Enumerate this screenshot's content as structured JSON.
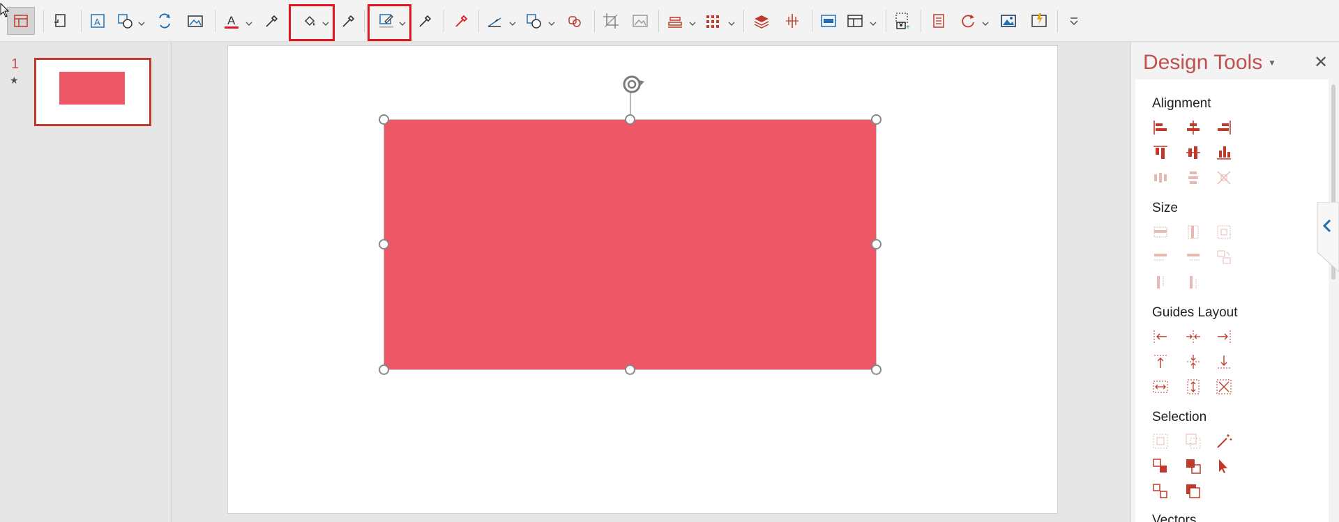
{
  "toolbar": {
    "icons": [
      "layout-icon",
      "rotate-image-icon",
      "text-box-icon",
      "shapes-icon",
      "replace-icon",
      "insert-picture-icon",
      "font-color-icon",
      "eyedropper-icon",
      "fill-color-icon",
      "eyedropper-icon",
      "outline-color-icon",
      "eyedropper-icon",
      "color-picker-icon",
      "shape-change-icon",
      "shape-outline-icon",
      "ungroup-icon",
      "crop-icon",
      "picture-icon",
      "align-icon",
      "grid-icon",
      "layers-icon",
      "center-guides-icon",
      "frame-icon",
      "table-icon",
      "screenshot-icon",
      "notes-icon",
      "refresh-icon",
      "image-icon",
      "presentation-icon",
      "more-icon"
    ],
    "highlighted": [
      "fill-color-button",
      "outline-color-button"
    ],
    "accent_red": "#e0141c"
  },
  "slides_panel": {
    "slide_number": "1",
    "animation_marker": "★"
  },
  "canvas": {
    "shape_fill": "#ee5766"
  },
  "design_pane": {
    "title": "Design Tools",
    "sections": [
      {
        "label": "Alignment"
      },
      {
        "label": "Size"
      },
      {
        "label": "Guides Layout"
      },
      {
        "label": "Selection"
      },
      {
        "label": "Vectors"
      }
    ]
  }
}
